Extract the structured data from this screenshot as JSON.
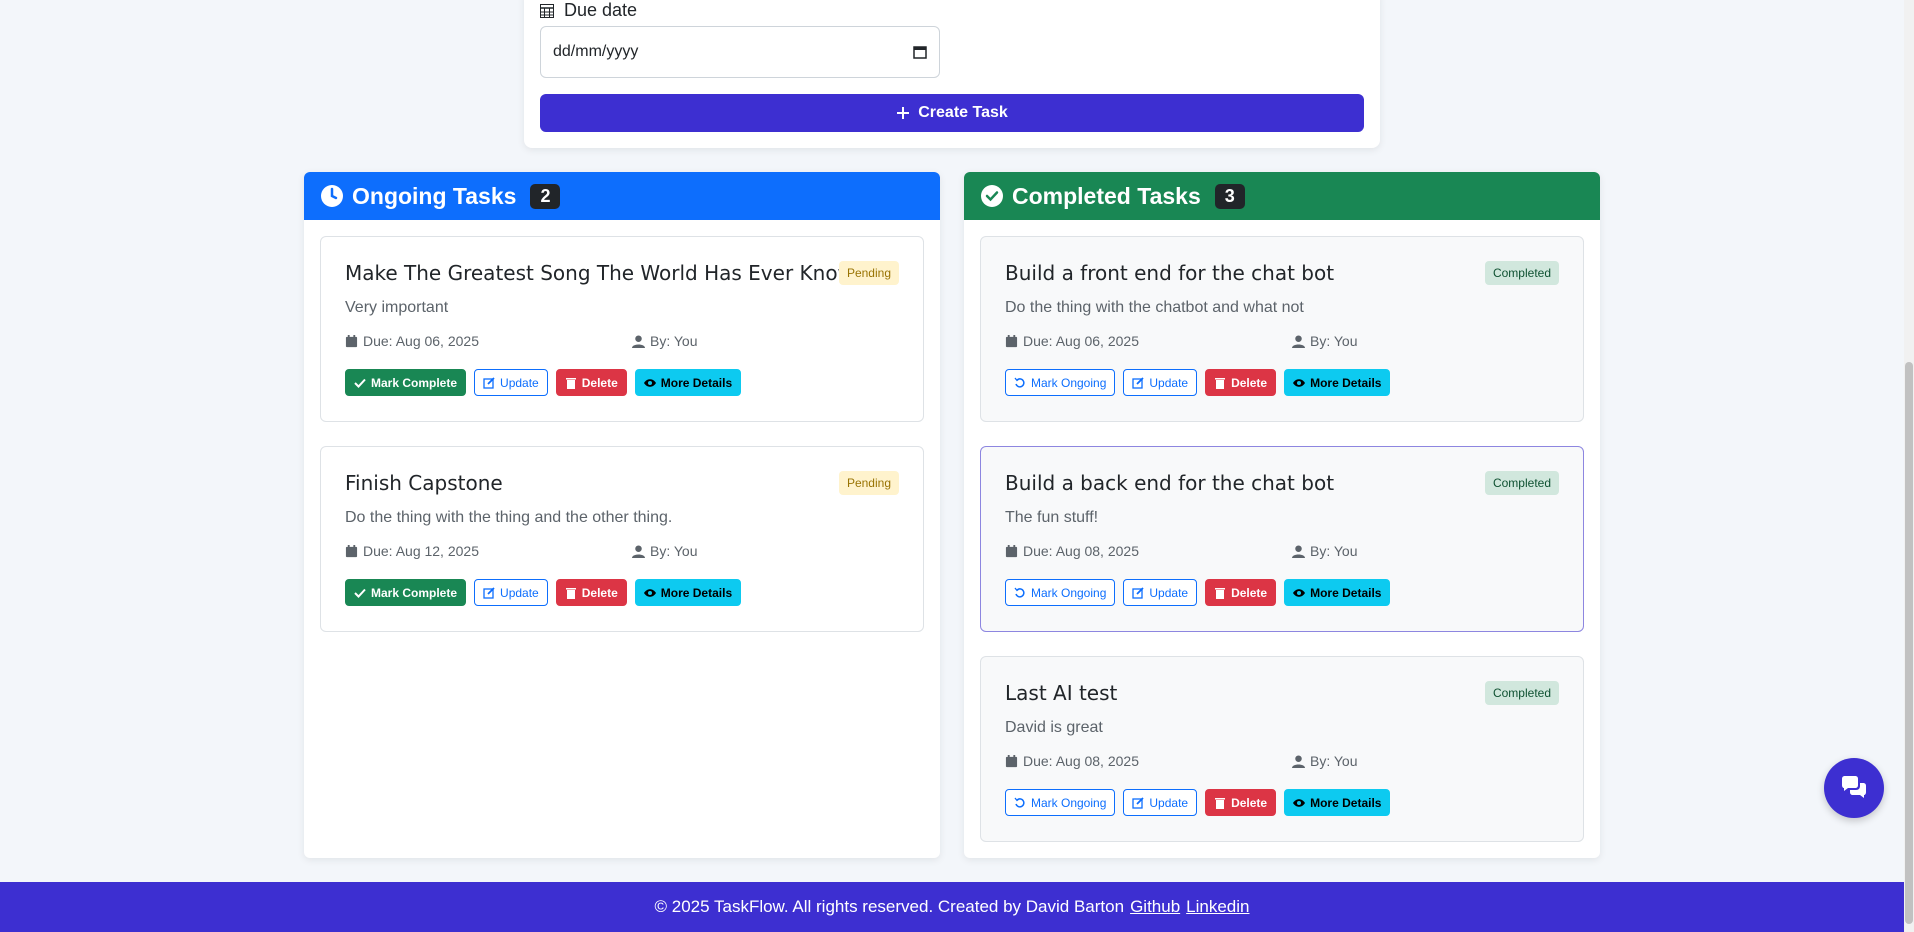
{
  "form": {
    "due_label": "Due date",
    "date_placeholder": "dd/mm/yyyy",
    "create_label": "Create Task"
  },
  "ongoing": {
    "title": "Ongoing Tasks",
    "count": "2",
    "color": "#0d6efd",
    "tasks": [
      {
        "title": "Make The Greatest Song The World Has Ever Known",
        "status": "Pending",
        "description": "Very important",
        "due": "Due: Aug 06, 2025",
        "by": "By: You",
        "actions": {
          "primary": "Mark Complete",
          "update": "Update",
          "delete": "Delete",
          "details": "More Details"
        }
      },
      {
        "title": "Finish Capstone",
        "status": "Pending",
        "description": "Do the thing with the thing and the other thing.",
        "due": "Due: Aug 12, 2025",
        "by": "By: You",
        "actions": {
          "primary": "Mark Complete",
          "update": "Update",
          "delete": "Delete",
          "details": "More Details"
        }
      }
    ]
  },
  "completed": {
    "title": "Completed Tasks",
    "count": "3",
    "color": "#198754",
    "tasks": [
      {
        "title": "Build a front end for the chat bot",
        "status": "Completed",
        "description": "Do the thing with the chatbot and what not",
        "due": "Due: Aug 06, 2025",
        "by": "By: You",
        "actions": {
          "primary": "Mark Ongoing",
          "update": "Update",
          "delete": "Delete",
          "details": "More Details"
        }
      },
      {
        "title": "Build a back end for the chat bot",
        "status": "Completed",
        "description": "The fun stuff!",
        "due": "Due: Aug 08, 2025",
        "by": "By: You",
        "actions": {
          "primary": "Mark Ongoing",
          "update": "Update",
          "delete": "Delete",
          "details": "More Details"
        }
      },
      {
        "title": "Last AI test",
        "status": "Completed",
        "description": "David is great",
        "due": "Due: Aug 08, 2025",
        "by": "By: You",
        "actions": {
          "primary": "Mark Ongoing",
          "update": "Update",
          "delete": "Delete",
          "details": "More Details"
        }
      }
    ]
  },
  "footer": {
    "text": "© 2025 TaskFlow. All rights reserved. Created by David Barton",
    "github": "Github",
    "linkedin": "Linkedin"
  },
  "colors": {
    "brand": "#3d2fd1",
    "pending_badge": "#fff3cd",
    "completed_badge": "#d1e7dd",
    "delete": "#dc3545",
    "details": "#0dcaf0"
  }
}
